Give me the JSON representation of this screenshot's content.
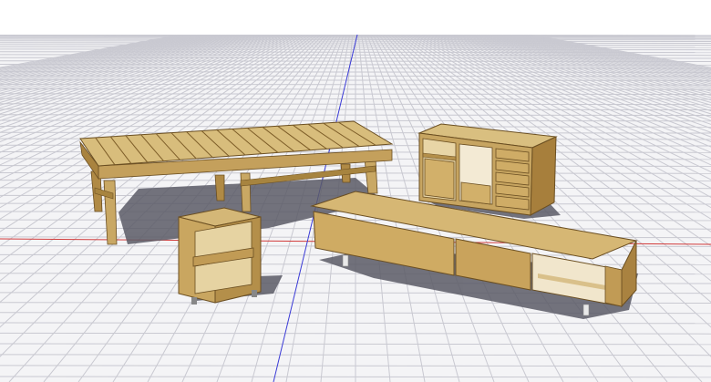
{
  "viewport": {
    "sky_color": "#ffffff",
    "ground_color": "#f4f4f6",
    "grid_color": "#c9c9d1",
    "axis_red": "#d23b3b",
    "axis_blue": "#3a3ad6"
  },
  "models": [
    {
      "name": "slatted-daybed",
      "wood_top": "#d8bd7c",
      "wood_side": "#b08a45",
      "wood_dark": "#8e6b32"
    },
    {
      "name": "sideboard-cabinet",
      "wood_top": "#d9bf80",
      "wood_side": "#b38d47",
      "wood_dark": "#8a672f"
    },
    {
      "name": "tv-console",
      "wood_top": "#d6b774",
      "wood_side": "#c29a55",
      "wood_dark": "#8e6b32"
    },
    {
      "name": "nightstand",
      "wood_top": "#d4b777",
      "wood_side": "#b48f4a",
      "wood_dark": "#8a672f"
    }
  ]
}
